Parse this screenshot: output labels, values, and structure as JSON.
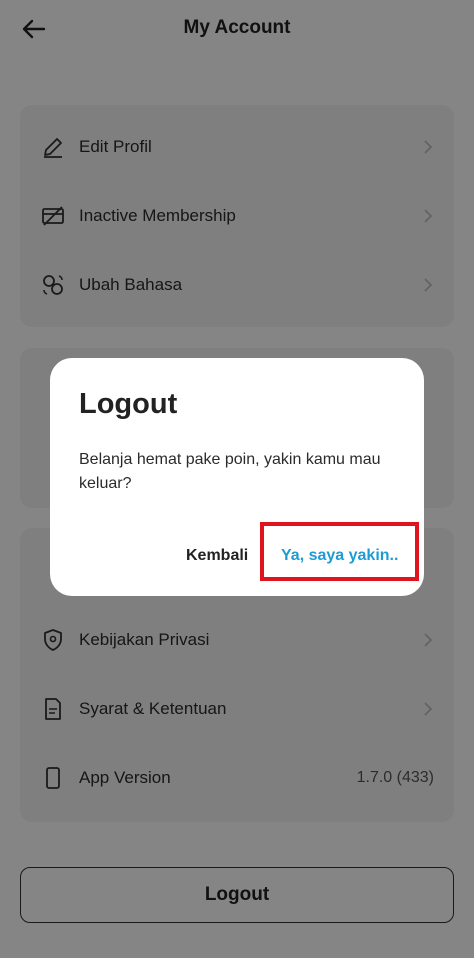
{
  "header": {
    "title": "My Account",
    "back_icon": "arrow-left-icon"
  },
  "group1": [
    {
      "label": "Edit Profil",
      "icon": "pencil-icon"
    },
    {
      "label": "Inactive Membership",
      "icon": "card-slash-icon"
    },
    {
      "label": "Ubah Bahasa",
      "icon": "language-swap-icon"
    }
  ],
  "group3": [
    {
      "label": "Kebijakan Privasi",
      "icon": "shield-icon"
    },
    {
      "label": "Syarat & Ketentuan",
      "icon": "document-icon"
    },
    {
      "label": "App Version",
      "icon": "phone-icon",
      "value": "1.7.0 (433)"
    }
  ],
  "logout_button": "Logout",
  "dialog": {
    "title": "Logout",
    "message": "Belanja hemat pake poin, yakin kamu mau keluar?",
    "cancel": "Kembali",
    "confirm": "Ya, saya yakin.."
  },
  "colors": {
    "confirm_text": "#1f9bd4",
    "highlight_border": "#e0141e"
  }
}
